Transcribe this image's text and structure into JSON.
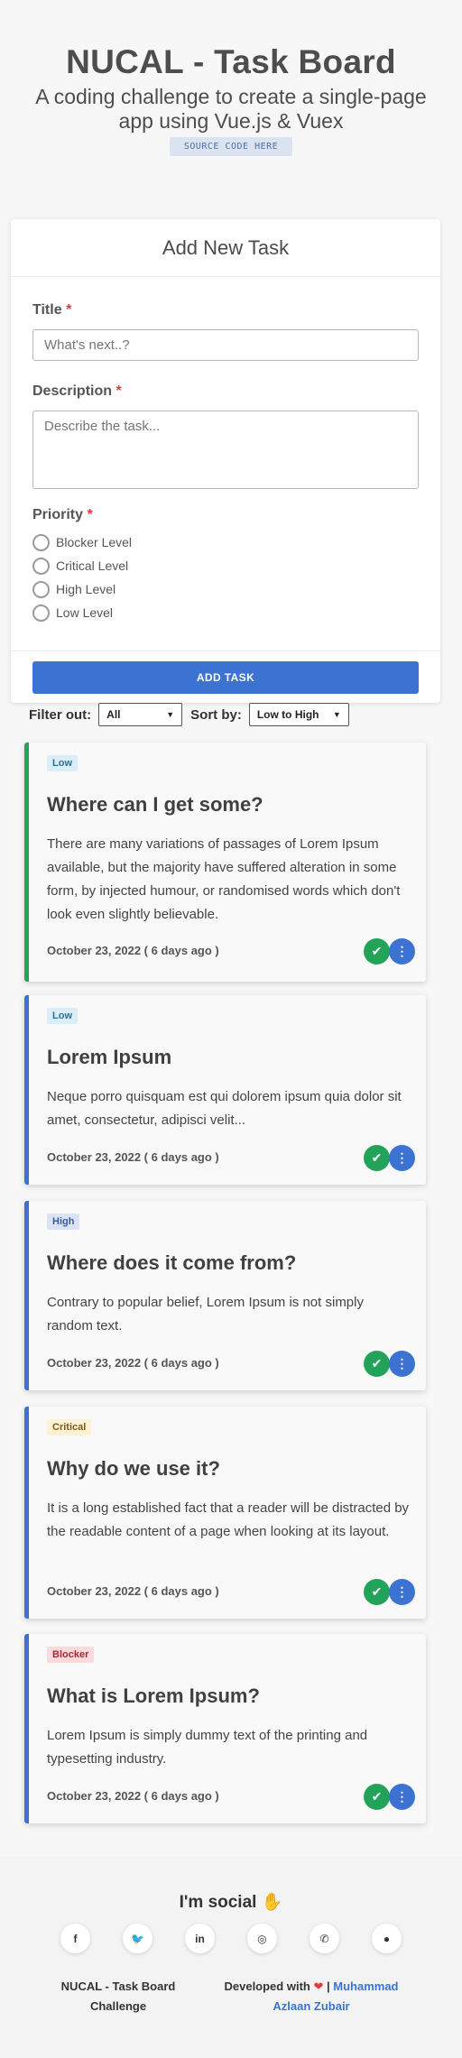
{
  "header": {
    "title": "NUCAL - Task Board",
    "subtitle": "A coding challenge to create a single-page app using Vue.js & Vuex",
    "source_button": "SOURCE CODE HERE"
  },
  "form": {
    "heading": "Add New Task",
    "title_label": "Title",
    "title_placeholder": "What's next..?",
    "description_label": "Description",
    "description_placeholder": "Describe the task...",
    "priority_label": "Priority",
    "required_mark": "*",
    "priority_options": [
      "Blocker Level",
      "Critical Level",
      "High Level",
      "Low Level"
    ],
    "submit_label": "ADD TASK"
  },
  "controls": {
    "filter_label": "Filter out:",
    "filter_value": "All",
    "sort_label": "Sort by:",
    "sort_value": "Low to High"
  },
  "tasks": [
    {
      "priority": "Low",
      "title": "Where can I get some?",
      "description": "There are many variations of passages of Lorem Ipsum available, but the majority have suffered alteration in some form, by injected humour, or randomised words which don't look even slightly believable.",
      "date": "October 23, 2022 ( 6 days ago )",
      "accent": "#23a35a",
      "badge_bg": "#d9eef8",
      "badge_fg": "#2f6f8f"
    },
    {
      "priority": "Low",
      "title": "Lorem Ipsum",
      "description": "Neque porro quisquam est qui dolorem ipsum quia dolor sit amet, consectetur, adipisci velit...",
      "date": "October 23, 2022 ( 6 days ago )",
      "accent": "#3c73d2",
      "badge_bg": "#d9eef8",
      "badge_fg": "#2f6f8f"
    },
    {
      "priority": "High",
      "title": "Where does it come from?",
      "description": "Contrary to popular belief, Lorem Ipsum is not simply random text.",
      "date": "October 23, 2022 ( 6 days ago )",
      "accent": "#3c73d2",
      "badge_bg": "#dbe3f4",
      "badge_fg": "#3b5a9a"
    },
    {
      "priority": "Critical",
      "title": "Why do we use it?",
      "description": "It is a long established fact that a reader will be distracted by the readable content of a page when looking at its layout.",
      "date": "October 23, 2022 ( 6 days ago )",
      "accent": "#3c73d2",
      "badge_bg": "#fdf1d6",
      "badge_fg": "#7a5a1a"
    },
    {
      "priority": "Blocker",
      "title": "What is Lorem Ipsum?",
      "description": "Lorem Ipsum is simply dummy text of the printing and typesetting industry.",
      "date": "October 23, 2022 ( 6 days ago )",
      "accent": "#3c73d2",
      "badge_bg": "#fadadd",
      "badge_fg": "#a12a35"
    }
  ],
  "footer": {
    "heading": "I'm social",
    "socials": [
      "facebook-icon",
      "twitter-icon",
      "linkedin-icon",
      "instagram-icon",
      "whatsapp-icon",
      "github-icon"
    ],
    "left_text": "NUCAL - Task Board Challenge",
    "developed_with": "Developed with",
    "separator": "|",
    "author": "Muhammad Azlaan Zubair"
  }
}
